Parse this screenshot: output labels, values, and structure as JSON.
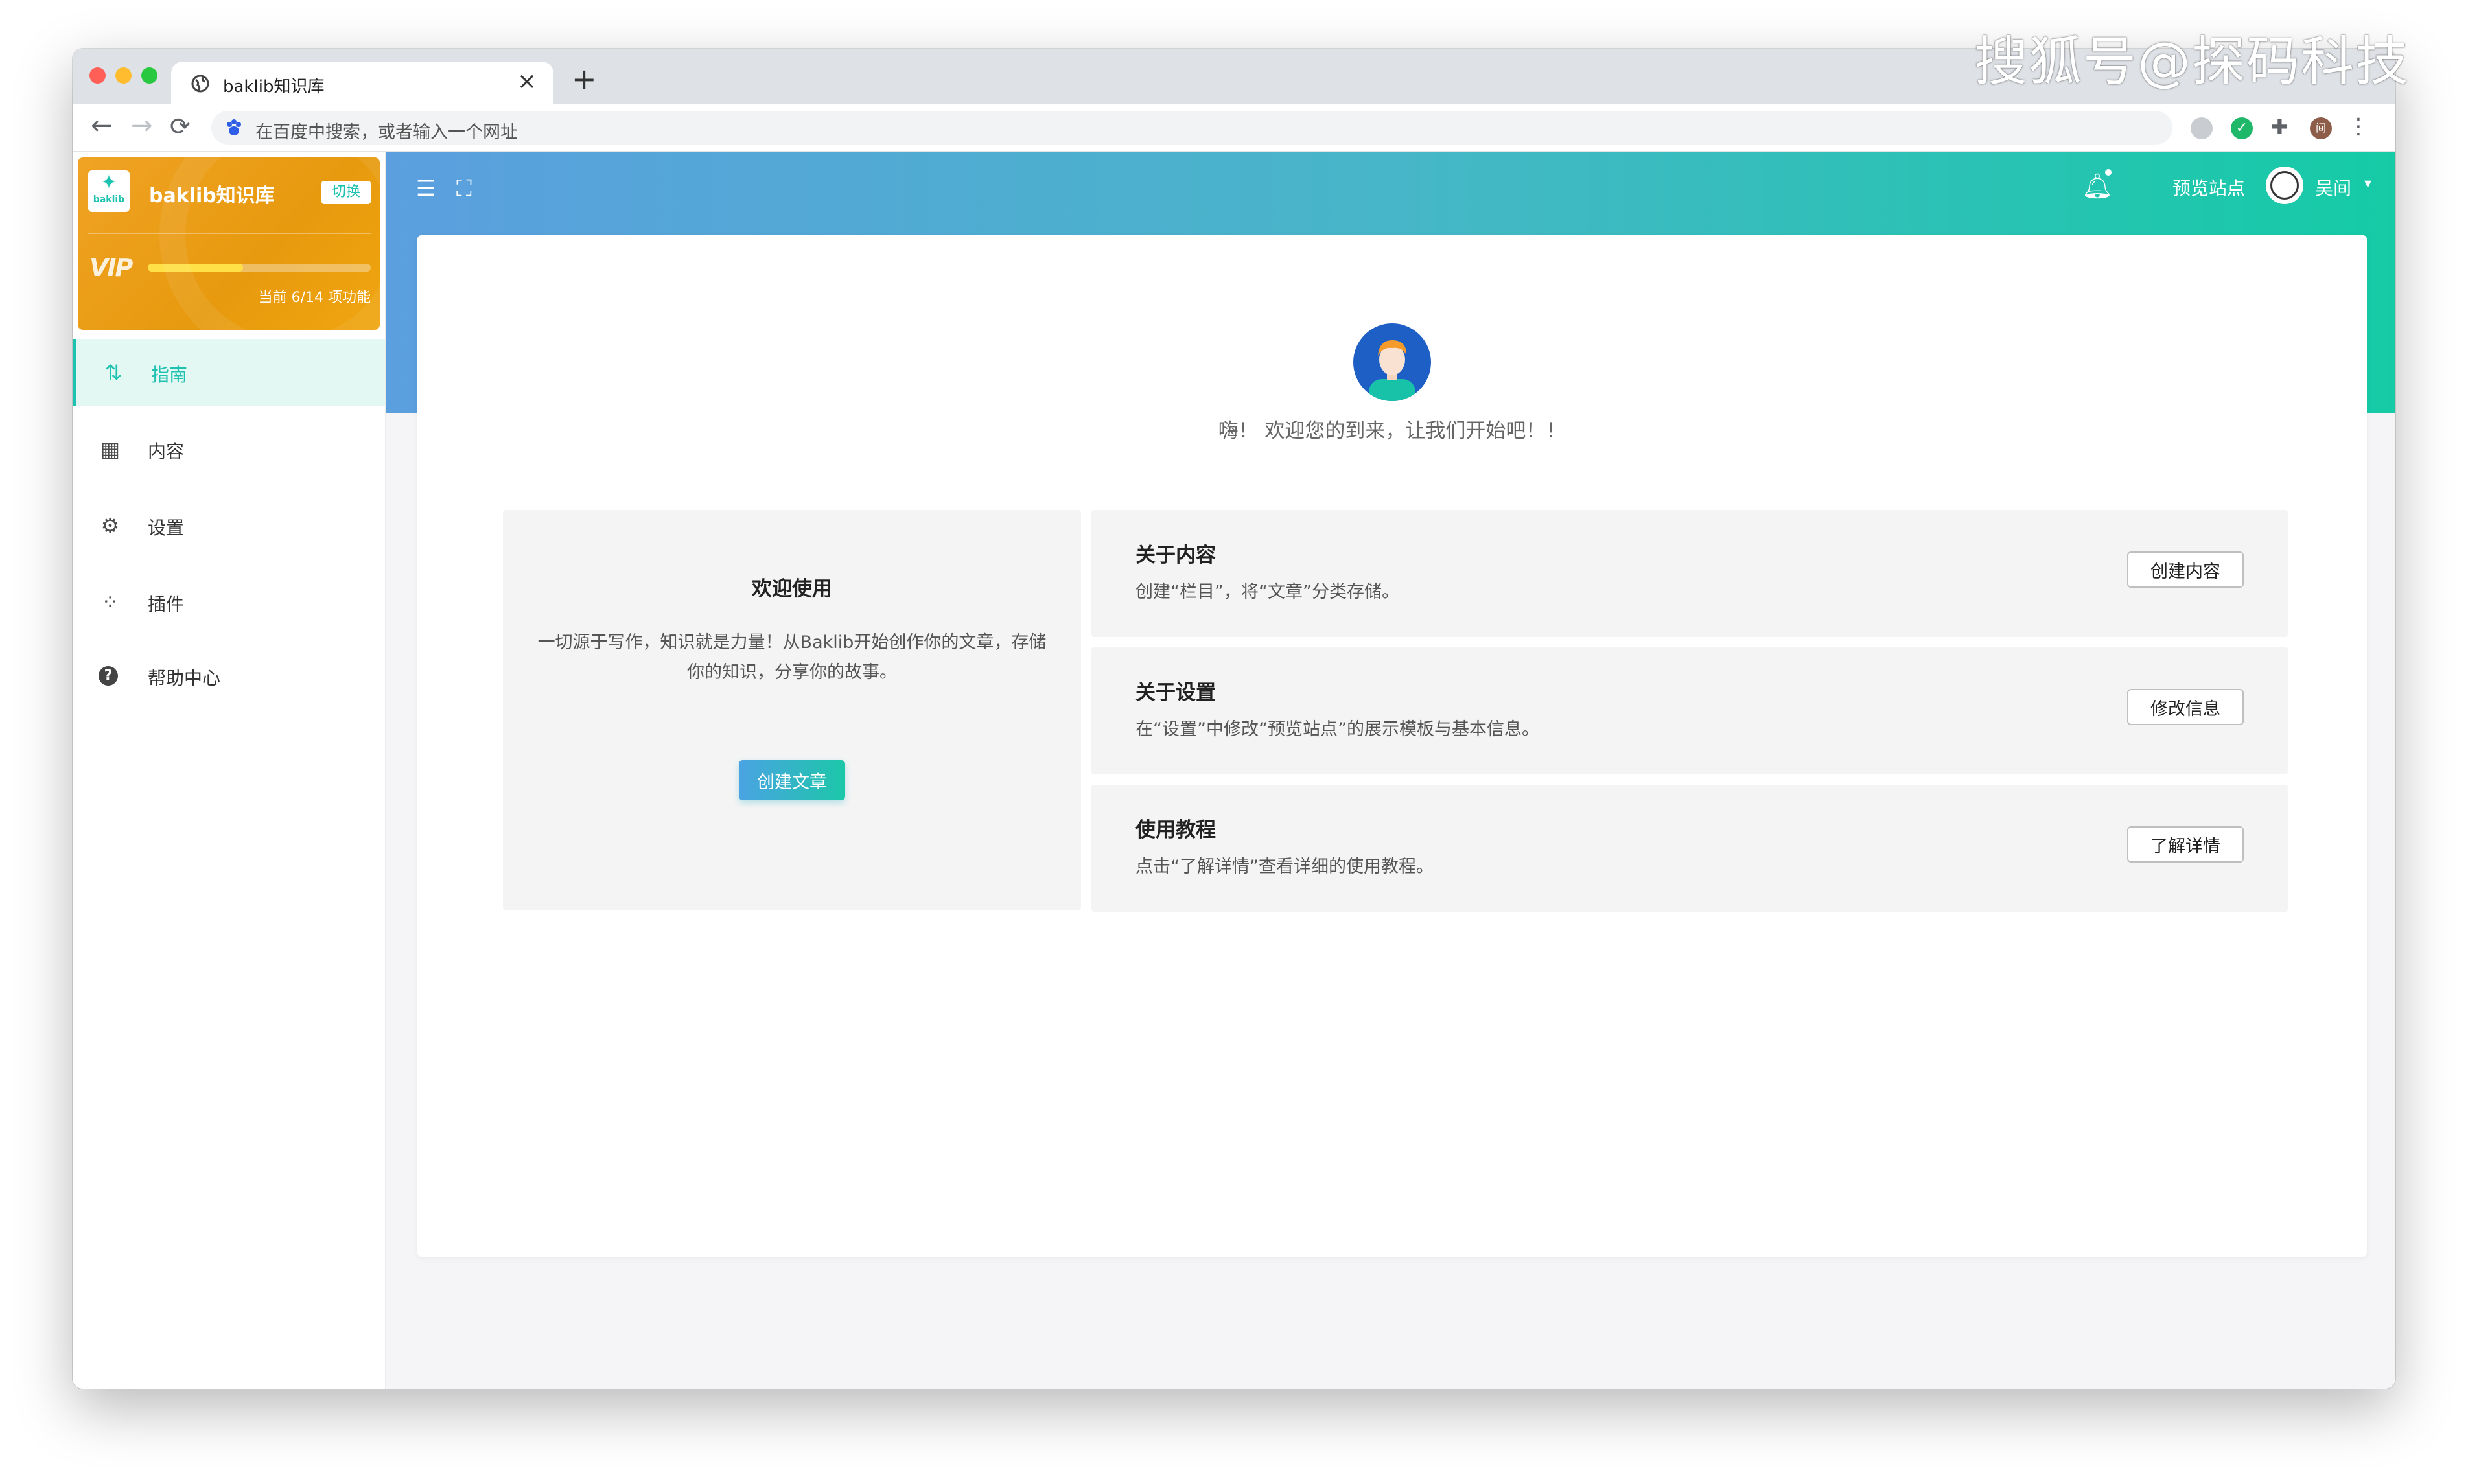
{
  "watermark": "搜狐号@探码科技",
  "browser": {
    "tab_title": "baklib知识库",
    "tab_close": "×",
    "new_tab": "+",
    "back": "←",
    "forward": "→",
    "reload": "⟳",
    "address_placeholder": "在百度中搜索，或者输入一个网址",
    "profile_initial": "间"
  },
  "sidebar": {
    "brand_name": "baklib知识库",
    "logo_text": "baklib",
    "switch_label": "切换",
    "vip_text": "VIP",
    "vip_progress": 0.4286,
    "vip_label": "当前 6/14 项功能",
    "items": [
      {
        "label": "指南",
        "icon": "signpost-icon",
        "glyph": "⇅",
        "active": true
      },
      {
        "label": "内容",
        "icon": "grid-icon",
        "glyph": "▦",
        "active": false
      },
      {
        "label": "设置",
        "icon": "gear-icon",
        "glyph": "⚙",
        "active": false
      },
      {
        "label": "插件",
        "icon": "apps-icon",
        "glyph": "⁘",
        "active": false
      },
      {
        "label": "帮助中心",
        "icon": "help-icon",
        "glyph": "?",
        "active": false
      }
    ]
  },
  "header": {
    "preview_label": "预览站点",
    "user_name": "吴间",
    "help_glyph": "?"
  },
  "main": {
    "welcome_text": "嗨！ 欢迎您的到来，让我们开始吧！！",
    "left_panel": {
      "title": "欢迎使用",
      "description": "一切源于写作，知识就是力量！从Baklib开始创作你的文章，存储你的知识，分享你的故事。",
      "button": "创建文章"
    },
    "cards": [
      {
        "title": "关于内容",
        "description": "创建“栏目”，将“文章”分类存储。",
        "button": "创建内容"
      },
      {
        "title": "关于设置",
        "description": "在“设置”中修改“预览站点”的展示模板与基本信息。",
        "button": "修改信息"
      },
      {
        "title": "使用教程",
        "description": "点击“了解详情”查看详细的使用教程。",
        "button": "了解详情"
      }
    ]
  },
  "colors": {
    "accent": "#1ec2b0",
    "brand_card": "#e99d14",
    "header_start": "#5b9fdf",
    "header_end": "#15cba6"
  }
}
